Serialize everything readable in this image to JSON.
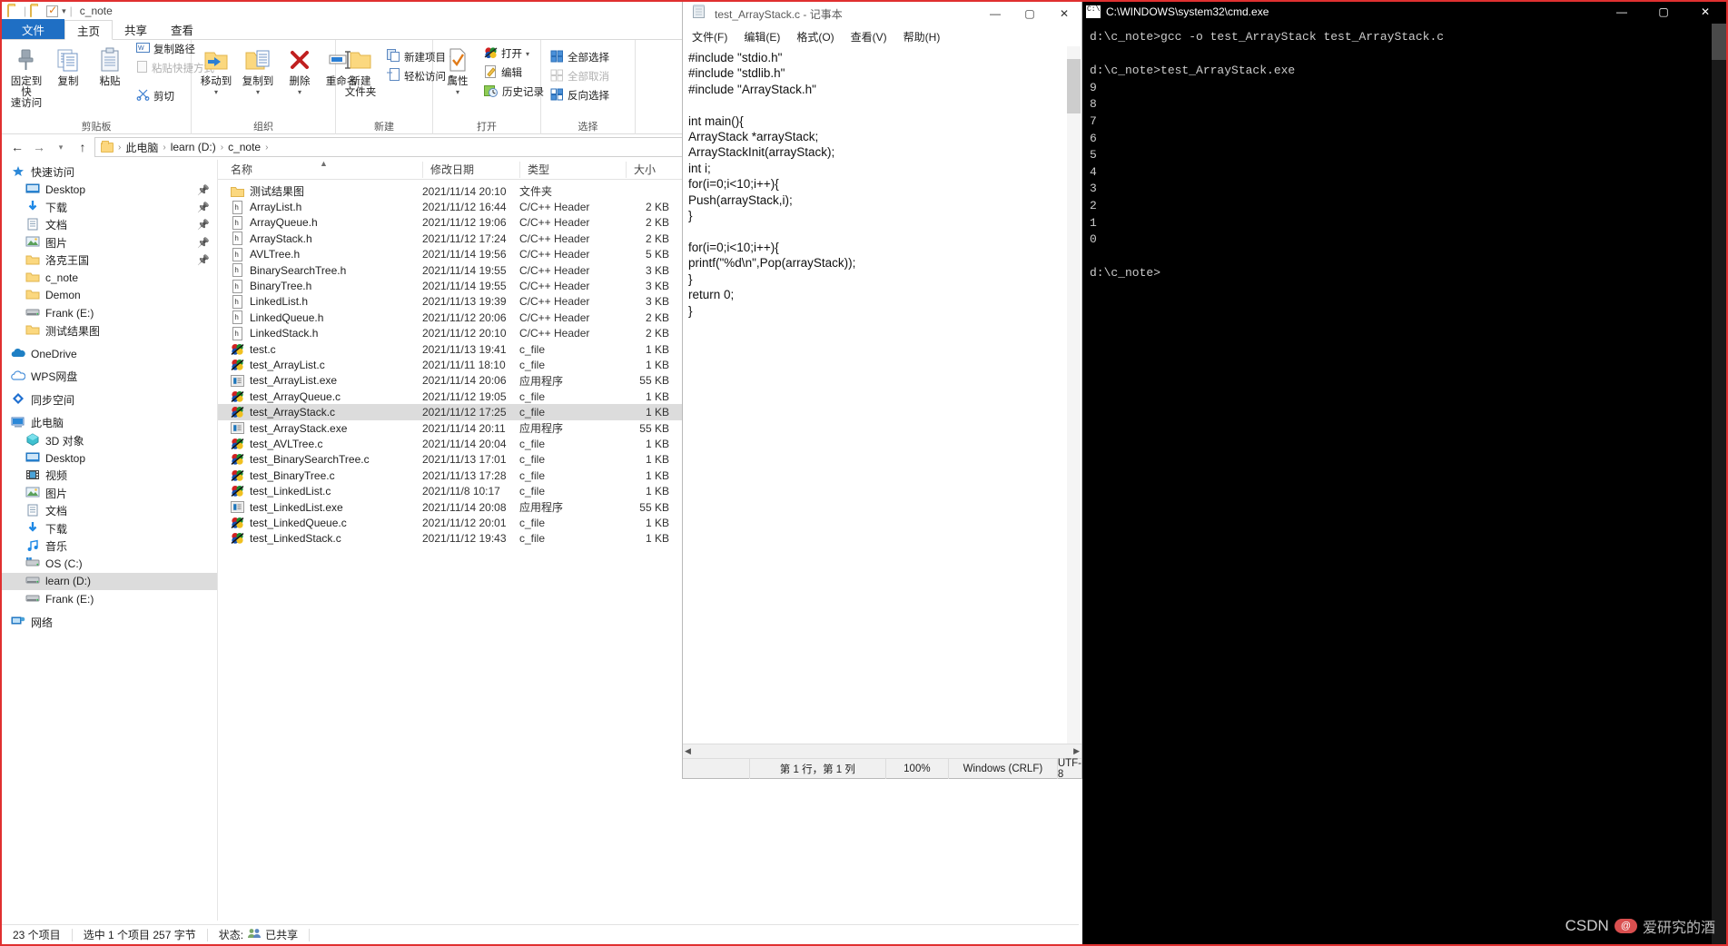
{
  "explorer": {
    "window_title": "c_note",
    "quick_access_icons": [
      "folder-icon",
      "folder-icon",
      "checkbox-icon",
      "chevron-down-icon"
    ],
    "tabs": [
      {
        "label": "文件",
        "active": false,
        "is_file_tab": true
      },
      {
        "label": "主页",
        "active": true
      },
      {
        "label": "共享",
        "active": false
      },
      {
        "label": "查看",
        "active": false
      }
    ],
    "ribbon": {
      "groups": [
        {
          "name": "剪贴板",
          "big": [
            {
              "label": "固定到快\n速访问",
              "icon": "pin-icon"
            },
            {
              "label": "复制",
              "icon": "copy-icon"
            },
            {
              "label": "粘贴",
              "icon": "paste-icon"
            }
          ],
          "small": [
            {
              "label": "复制路径",
              "icon": "copy-path-icon",
              "dim": false
            },
            {
              "label": "粘贴快捷方式",
              "icon": "paste-shortcut-icon",
              "dim": true
            },
            {
              "label": "剪切",
              "icon": "scissors-icon",
              "dim": false
            }
          ]
        },
        {
          "name": "组织",
          "big": [
            {
              "label": "移动到",
              "icon": "move-to-icon",
              "caret": true
            },
            {
              "label": "复制到",
              "icon": "copy-to-icon",
              "caret": true
            },
            {
              "label": "删除",
              "icon": "delete-icon",
              "caret": true
            },
            {
              "label": "重命名",
              "icon": "rename-icon"
            }
          ],
          "small": []
        },
        {
          "name": "新建",
          "big": [
            {
              "label": "新建\n文件夹",
              "icon": "new-folder-icon"
            }
          ],
          "small": [
            {
              "label": "新建项目",
              "icon": "new-item-icon",
              "caret": true
            },
            {
              "label": "轻松访问",
              "icon": "easy-access-icon",
              "caret": true
            }
          ]
        },
        {
          "name": "打开",
          "big": [
            {
              "label": "属性",
              "icon": "properties-icon",
              "caret": true
            }
          ],
          "small": [
            {
              "label": "打开",
              "icon": "open-icon",
              "caret": true
            },
            {
              "label": "编辑",
              "icon": "edit-icon"
            },
            {
              "label": "历史记录",
              "icon": "history-icon"
            }
          ]
        },
        {
          "name": "选择",
          "big": [],
          "small": [
            {
              "label": "全部选择",
              "icon": "select-all-icon"
            },
            {
              "label": "全部取消",
              "icon": "select-none-icon",
              "dim": true
            },
            {
              "label": "反向选择",
              "icon": "invert-selection-icon"
            }
          ]
        }
      ]
    },
    "address": {
      "back_icon": "arrow-left-icon",
      "forward_icon": "arrow-right-icon",
      "recent_icon": "chevron-down-icon",
      "up_icon": "arrow-up-icon",
      "crumbs": [
        "此电脑",
        "learn (D:)",
        "c_note"
      ]
    },
    "nav_pane": [
      {
        "label": "快速访问",
        "icon": "star-pin-icon",
        "indent": 0,
        "selected": false
      },
      {
        "label": "Desktop",
        "icon": "desktop-icon",
        "indent": 1,
        "selected": false,
        "pinned": true
      },
      {
        "label": "下载",
        "icon": "downloads-icon",
        "indent": 1,
        "selected": false,
        "pinned": true
      },
      {
        "label": "文档",
        "icon": "documents-icon",
        "indent": 1,
        "selected": false,
        "pinned": true
      },
      {
        "label": "图片",
        "icon": "pictures-icon",
        "indent": 1,
        "selected": false,
        "pinned": true
      },
      {
        "label": "洛克王国",
        "icon": "folder-icon",
        "indent": 1,
        "selected": false,
        "pinned": true
      },
      {
        "label": "c_note",
        "icon": "folder-icon",
        "indent": 1,
        "selected": false
      },
      {
        "label": "Demon",
        "icon": "folder-icon",
        "indent": 1,
        "selected": false
      },
      {
        "label": "Frank (E:)",
        "icon": "drive-icon",
        "indent": 1,
        "selected": false
      },
      {
        "label": "测试结果图",
        "icon": "folder-icon",
        "indent": 1,
        "selected": false
      },
      {
        "label": "OneDrive",
        "icon": "onedrive-icon",
        "indent": 0,
        "selected": false,
        "gap": true
      },
      {
        "label": "WPS网盘",
        "icon": "wps-cloud-icon",
        "indent": 0,
        "selected": false,
        "gap": true
      },
      {
        "label": "同步空间",
        "icon": "sync-space-icon",
        "indent": 0,
        "selected": false,
        "gap": true
      },
      {
        "label": "此电脑",
        "icon": "this-pc-icon",
        "indent": 0,
        "selected": false,
        "gap": true
      },
      {
        "label": "3D 对象",
        "icon": "3d-objects-icon",
        "indent": 1,
        "selected": false
      },
      {
        "label": "Desktop",
        "icon": "desktop-icon",
        "indent": 1,
        "selected": false
      },
      {
        "label": "视频",
        "icon": "videos-icon",
        "indent": 1,
        "selected": false
      },
      {
        "label": "图片",
        "icon": "pictures-icon",
        "indent": 1,
        "selected": false
      },
      {
        "label": "文档",
        "icon": "documents-icon",
        "indent": 1,
        "selected": false
      },
      {
        "label": "下载",
        "icon": "downloads-icon",
        "indent": 1,
        "selected": false
      },
      {
        "label": "音乐",
        "icon": "music-icon",
        "indent": 1,
        "selected": false
      },
      {
        "label": "OS (C:)",
        "icon": "os-drive-icon",
        "indent": 1,
        "selected": false
      },
      {
        "label": "learn (D:)",
        "icon": "drive-icon",
        "indent": 1,
        "selected": true
      },
      {
        "label": "Frank (E:)",
        "icon": "drive-icon",
        "indent": 1,
        "selected": false
      },
      {
        "label": "网络",
        "icon": "network-icon",
        "indent": 0,
        "selected": false,
        "gap": true
      }
    ],
    "columns": [
      "名称",
      "修改日期",
      "类型",
      "大小"
    ],
    "sort_column": "名称",
    "files": [
      {
        "name": "测试结果图",
        "date": "2021/11/14 20:10",
        "type": "文件夹",
        "size": "",
        "icon": "folder-icon",
        "selected": false
      },
      {
        "name": "ArrayList.h",
        "date": "2021/11/12 16:44",
        "type": "C/C++ Header",
        "size": "2 KB",
        "icon": "h-file-icon",
        "selected": false
      },
      {
        "name": "ArrayQueue.h",
        "date": "2021/11/12 19:06",
        "type": "C/C++ Header",
        "size": "2 KB",
        "icon": "h-file-icon",
        "selected": false
      },
      {
        "name": "ArrayStack.h",
        "date": "2021/11/12 17:24",
        "type": "C/C++ Header",
        "size": "2 KB",
        "icon": "h-file-icon",
        "selected": false
      },
      {
        "name": "AVLTree.h",
        "date": "2021/11/14 19:56",
        "type": "C/C++ Header",
        "size": "5 KB",
        "icon": "h-file-icon",
        "selected": false
      },
      {
        "name": "BinarySearchTree.h",
        "date": "2021/11/14 19:55",
        "type": "C/C++ Header",
        "size": "3 KB",
        "icon": "h-file-icon",
        "selected": false
      },
      {
        "name": "BinaryTree.h",
        "date": "2021/11/14 19:55",
        "type": "C/C++ Header",
        "size": "3 KB",
        "icon": "h-file-icon",
        "selected": false
      },
      {
        "name": "LinkedList.h",
        "date": "2021/11/13 19:39",
        "type": "C/C++ Header",
        "size": "3 KB",
        "icon": "h-file-icon",
        "selected": false
      },
      {
        "name": "LinkedQueue.h",
        "date": "2021/11/12 20:06",
        "type": "C/C++ Header",
        "size": "2 KB",
        "icon": "h-file-icon",
        "selected": false
      },
      {
        "name": "LinkedStack.h",
        "date": "2021/11/12 20:10",
        "type": "C/C++ Header",
        "size": "2 KB",
        "icon": "h-file-icon",
        "selected": false
      },
      {
        "name": "test.c",
        "date": "2021/11/13 19:41",
        "type": "c_file",
        "size": "1 KB",
        "icon": "c-file-icon",
        "selected": false
      },
      {
        "name": "test_ArrayList.c",
        "date": "2021/11/11 18:10",
        "type": "c_file",
        "size": "1 KB",
        "icon": "c-file-icon",
        "selected": false
      },
      {
        "name": "test_ArrayList.exe",
        "date": "2021/11/14 20:06",
        "type": "应用程序",
        "size": "55 KB",
        "icon": "exe-file-icon",
        "selected": false
      },
      {
        "name": "test_ArrayQueue.c",
        "date": "2021/11/12 19:05",
        "type": "c_file",
        "size": "1 KB",
        "icon": "c-file-icon",
        "selected": false
      },
      {
        "name": "test_ArrayStack.c",
        "date": "2021/11/12 17:25",
        "type": "c_file",
        "size": "1 KB",
        "icon": "c-file-icon",
        "selected": true
      },
      {
        "name": "test_ArrayStack.exe",
        "date": "2021/11/14 20:11",
        "type": "应用程序",
        "size": "55 KB",
        "icon": "exe-file-icon",
        "selected": false
      },
      {
        "name": "test_AVLTree.c",
        "date": "2021/11/14 20:04",
        "type": "c_file",
        "size": "1 KB",
        "icon": "c-file-icon",
        "selected": false
      },
      {
        "name": "test_BinarySearchTree.c",
        "date": "2021/11/13 17:01",
        "type": "c_file",
        "size": "1 KB",
        "icon": "c-file-icon",
        "selected": false
      },
      {
        "name": "test_BinaryTree.c",
        "date": "2021/11/13 17:28",
        "type": "c_file",
        "size": "1 KB",
        "icon": "c-file-icon",
        "selected": false
      },
      {
        "name": "test_LinkedList.c",
        "date": "2021/11/8 10:17",
        "type": "c_file",
        "size": "1 KB",
        "icon": "c-file-icon",
        "selected": false
      },
      {
        "name": "test_LinkedList.exe",
        "date": "2021/11/14 20:08",
        "type": "应用程序",
        "size": "55 KB",
        "icon": "exe-file-icon",
        "selected": false
      },
      {
        "name": "test_LinkedQueue.c",
        "date": "2021/11/12 20:01",
        "type": "c_file",
        "size": "1 KB",
        "icon": "c-file-icon",
        "selected": false
      },
      {
        "name": "test_LinkedStack.c",
        "date": "2021/11/12 19:43",
        "type": "c_file",
        "size": "1 KB",
        "icon": "c-file-icon",
        "selected": false
      }
    ],
    "status": {
      "item_count": "23 个项目",
      "selection": "选中 1 个项目  257 字节",
      "share_label": "状态:",
      "share_value": "已共享"
    }
  },
  "notepad": {
    "title": "test_ArrayStack.c - 记事本",
    "icon": "notepad-icon",
    "menu": [
      "文件(F)",
      "编辑(E)",
      "格式(O)",
      "查看(V)",
      "帮助(H)"
    ],
    "controls": {
      "minimize": "—",
      "maximize": "▢",
      "close": "✕"
    },
    "content": "#include \"stdio.h\"\n#include \"stdlib.h\"\n#include \"ArrayStack.h\"\n\nint main(){\nArrayStack *arrayStack;\nArrayStackInit(arrayStack);\nint i;\nfor(i=0;i<10;i++){\nPush(arrayStack,i);\n}\n\nfor(i=0;i<10;i++){\nprintf(\"%d\\n\",Pop(arrayStack));\n}\nreturn 0;\n}",
    "status": {
      "position": "第 1 行，第 1 列",
      "zoom": "100%",
      "line_ending": "Windows (CRLF)",
      "encoding": "UTF-8"
    }
  },
  "cmd": {
    "title": "C:\\WINDOWS\\system32\\cmd.exe",
    "icon": "cmd-icon",
    "controls": {
      "minimize": "—",
      "maximize": "▢",
      "close": "✕"
    },
    "content": "d:\\c_note>gcc -o test_ArrayStack test_ArrayStack.c\n\nd:\\c_note>test_ArrayStack.exe\n9\n8\n7\n6\n5\n4\n3\n2\n1\n0\n\nd:\\c_note>"
  },
  "watermark": {
    "brand": "CSDN",
    "badge": "@",
    "handle": "爱研究的酒"
  }
}
